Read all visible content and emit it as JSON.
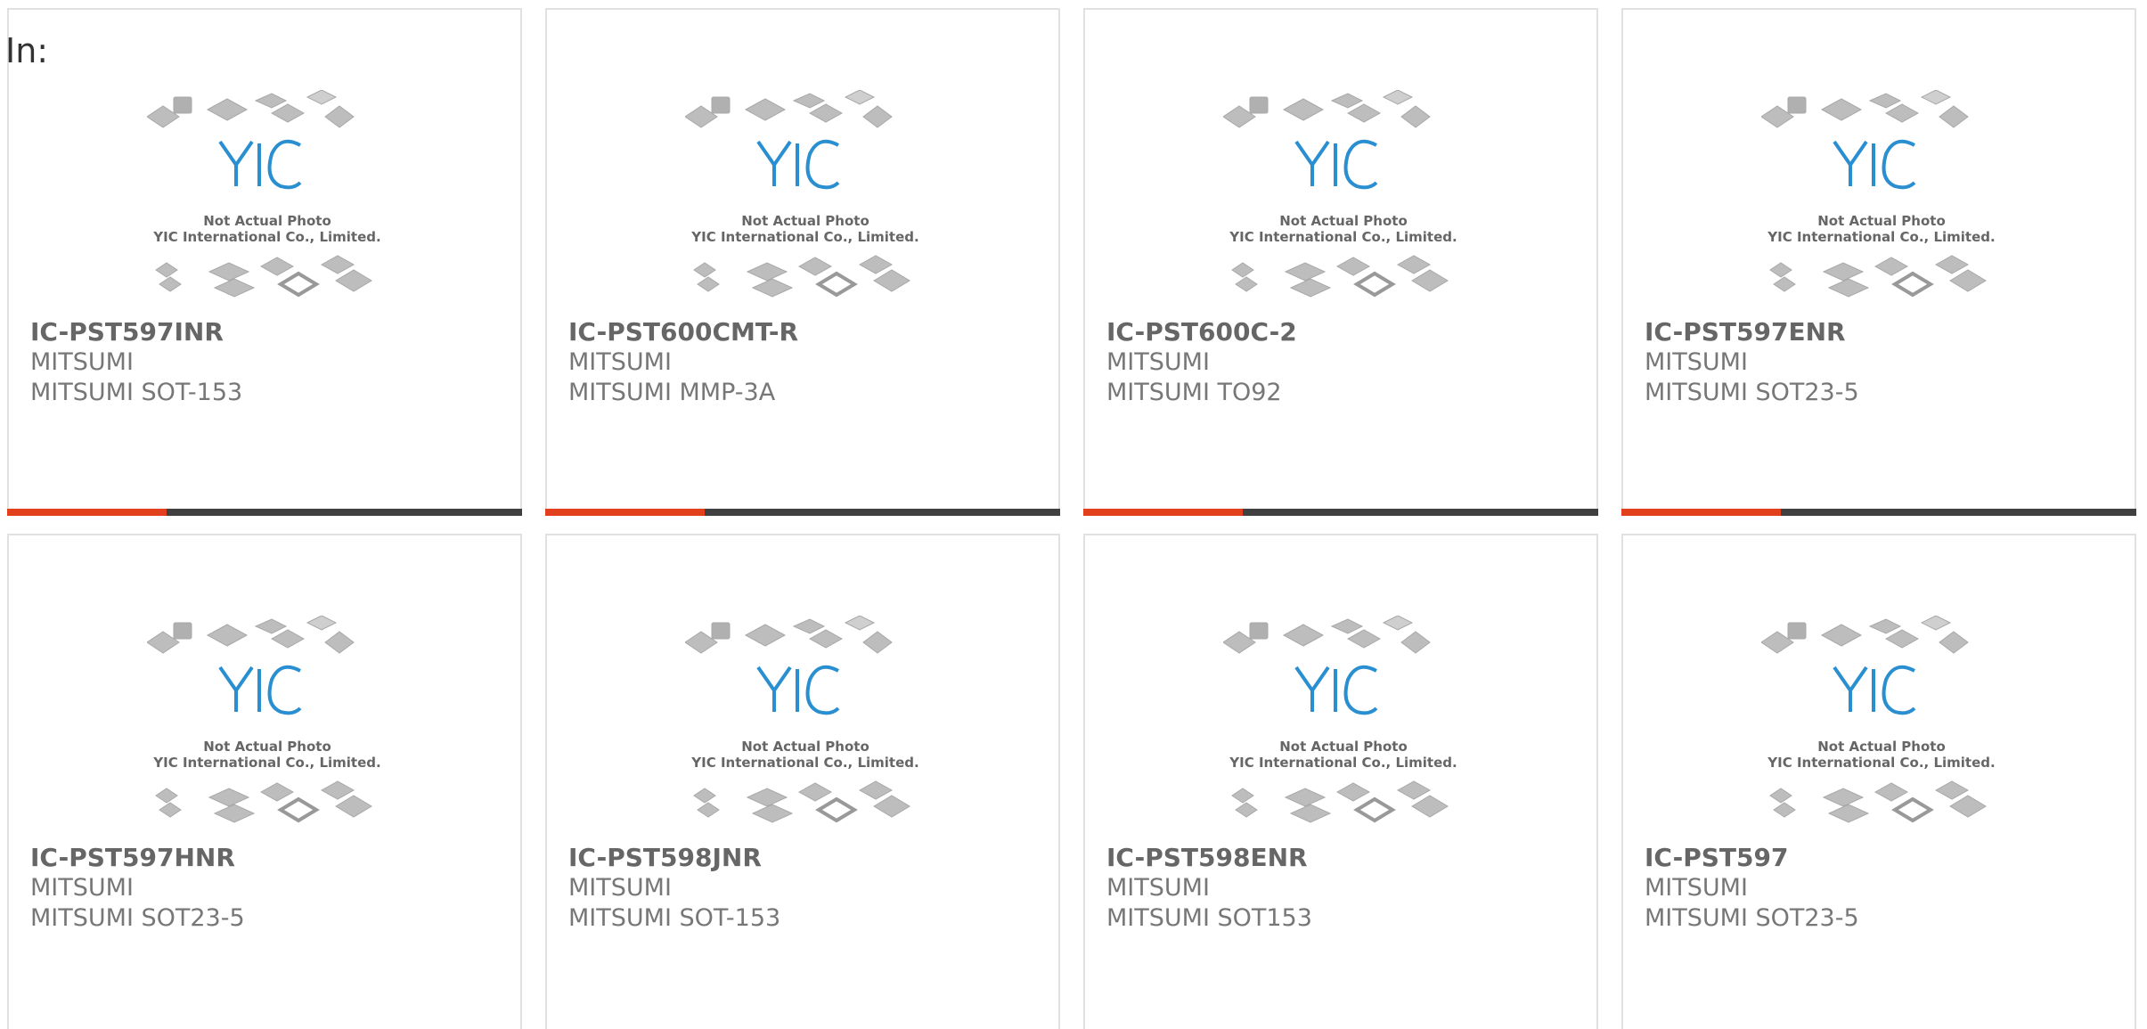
{
  "filter_label": "In:",
  "colors": {
    "accent": "#e2401c",
    "bar_track": "#404040",
    "text": "#777777",
    "logo_blue": "#2a8fd0"
  },
  "placeholder_image": {
    "line1": "Not Actual Photo",
    "line2": "YIC International Co., Limited.",
    "logo": "YIC"
  },
  "products": [
    {
      "part": "IC-PST597INR",
      "brand": "MITSUMI",
      "package": "MITSUMI SOT-153",
      "progress": 0.31
    },
    {
      "part": "IC-PST600CMT-R",
      "brand": "MITSUMI",
      "package": "MITSUMI MMP-3A",
      "progress": 0.31
    },
    {
      "part": "IC-PST600C-2",
      "brand": "MITSUMI",
      "package": "MITSUMI TO92",
      "progress": 0.31
    },
    {
      "part": "IC-PST597ENR",
      "brand": "MITSUMI",
      "package": "MITSUMI SOT23-5",
      "progress": 0.31
    },
    {
      "part": "IC-PST597HNR",
      "brand": "MITSUMI",
      "package": "MITSUMI SOT23-5"
    },
    {
      "part": "IC-PST598JNR",
      "brand": "MITSUMI",
      "package": "MITSUMI SOT-153"
    },
    {
      "part": "IC-PST598ENR",
      "brand": "MITSUMI",
      "package": "MITSUMI SOT153"
    },
    {
      "part": "IC-PST597",
      "brand": "MITSUMI",
      "package": "MITSUMI SOT23-5"
    }
  ]
}
